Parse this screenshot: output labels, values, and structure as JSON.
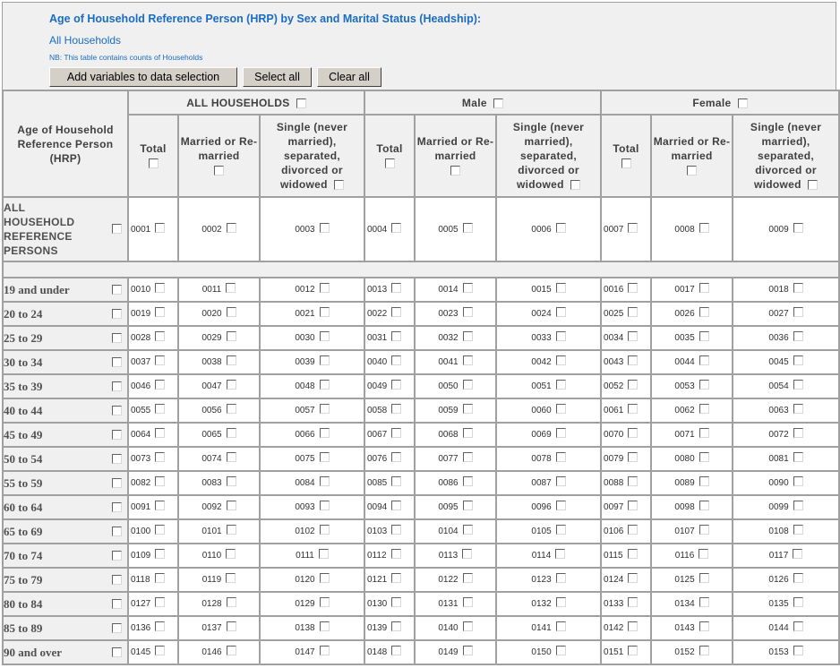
{
  "header": {
    "title": "Age of Household Reference Person (HRP) by Sex and Marital Status (Headship):",
    "subtitle": "All Households",
    "note": "NB: This table contains counts of Households",
    "buttons": {
      "add": "Add variables to data selection",
      "select_all": "Select all",
      "clear_all": "Clear all"
    }
  },
  "table": {
    "stub_header": "Age of Household Reference Person (HRP)",
    "groups": [
      "ALL HOUSEHOLDS",
      "Male",
      "Female"
    ],
    "subcolumns": [
      "Total",
      "Married or Re-married",
      "Single (never married), separated, divorced or widowed"
    ],
    "rows": [
      {
        "label": "ALL HOUSEHOLD REFERENCE PERSONS",
        "codes": [
          "0001",
          "0002",
          "0003",
          "0004",
          "0005",
          "0006",
          "0007",
          "0008",
          "0009"
        ]
      },
      {
        "label": "19 and under",
        "codes": [
          "0010",
          "0011",
          "0012",
          "0013",
          "0014",
          "0015",
          "0016",
          "0017",
          "0018"
        ]
      },
      {
        "label": "20 to 24",
        "codes": [
          "0019",
          "0020",
          "0021",
          "0022",
          "0023",
          "0024",
          "0025",
          "0026",
          "0027"
        ]
      },
      {
        "label": "25 to 29",
        "codes": [
          "0028",
          "0029",
          "0030",
          "0031",
          "0032",
          "0033",
          "0034",
          "0035",
          "0036"
        ]
      },
      {
        "label": "30 to 34",
        "codes": [
          "0037",
          "0038",
          "0039",
          "0040",
          "0041",
          "0042",
          "0043",
          "0044",
          "0045"
        ]
      },
      {
        "label": "35 to 39",
        "codes": [
          "0046",
          "0047",
          "0048",
          "0049",
          "0050",
          "0051",
          "0052",
          "0053",
          "0054"
        ]
      },
      {
        "label": "40 to 44",
        "codes": [
          "0055",
          "0056",
          "0057",
          "0058",
          "0059",
          "0060",
          "0061",
          "0062",
          "0063"
        ]
      },
      {
        "label": "45 to 49",
        "codes": [
          "0064",
          "0065",
          "0066",
          "0067",
          "0068",
          "0069",
          "0070",
          "0071",
          "0072"
        ]
      },
      {
        "label": "50 to 54",
        "codes": [
          "0073",
          "0074",
          "0075",
          "0076",
          "0077",
          "0078",
          "0079",
          "0080",
          "0081"
        ]
      },
      {
        "label": "55 to 59",
        "codes": [
          "0082",
          "0083",
          "0084",
          "0085",
          "0086",
          "0087",
          "0088",
          "0089",
          "0090"
        ]
      },
      {
        "label": "60 to 64",
        "codes": [
          "0091",
          "0092",
          "0093",
          "0094",
          "0095",
          "0096",
          "0097",
          "0098",
          "0099"
        ]
      },
      {
        "label": "65 to 69",
        "codes": [
          "0100",
          "0101",
          "0102",
          "0103",
          "0104",
          "0105",
          "0106",
          "0107",
          "0108"
        ]
      },
      {
        "label": "70 to 74",
        "codes": [
          "0109",
          "0110",
          "0111",
          "0112",
          "0113",
          "0114",
          "0115",
          "0116",
          "0117"
        ]
      },
      {
        "label": "75 to 79",
        "codes": [
          "0118",
          "0119",
          "0120",
          "0121",
          "0122",
          "0123",
          "0124",
          "0125",
          "0126"
        ]
      },
      {
        "label": "80 to 84",
        "codes": [
          "0127",
          "0128",
          "0129",
          "0130",
          "0131",
          "0132",
          "0133",
          "0134",
          "0135"
        ]
      },
      {
        "label": "85 to 89",
        "codes": [
          "0136",
          "0137",
          "0138",
          "0139",
          "0140",
          "0141",
          "0142",
          "0143",
          "0144"
        ]
      },
      {
        "label": "90 and over",
        "codes": [
          "0145",
          "0146",
          "0147",
          "0148",
          "0149",
          "0150",
          "0151",
          "0152",
          "0153"
        ]
      }
    ]
  }
}
